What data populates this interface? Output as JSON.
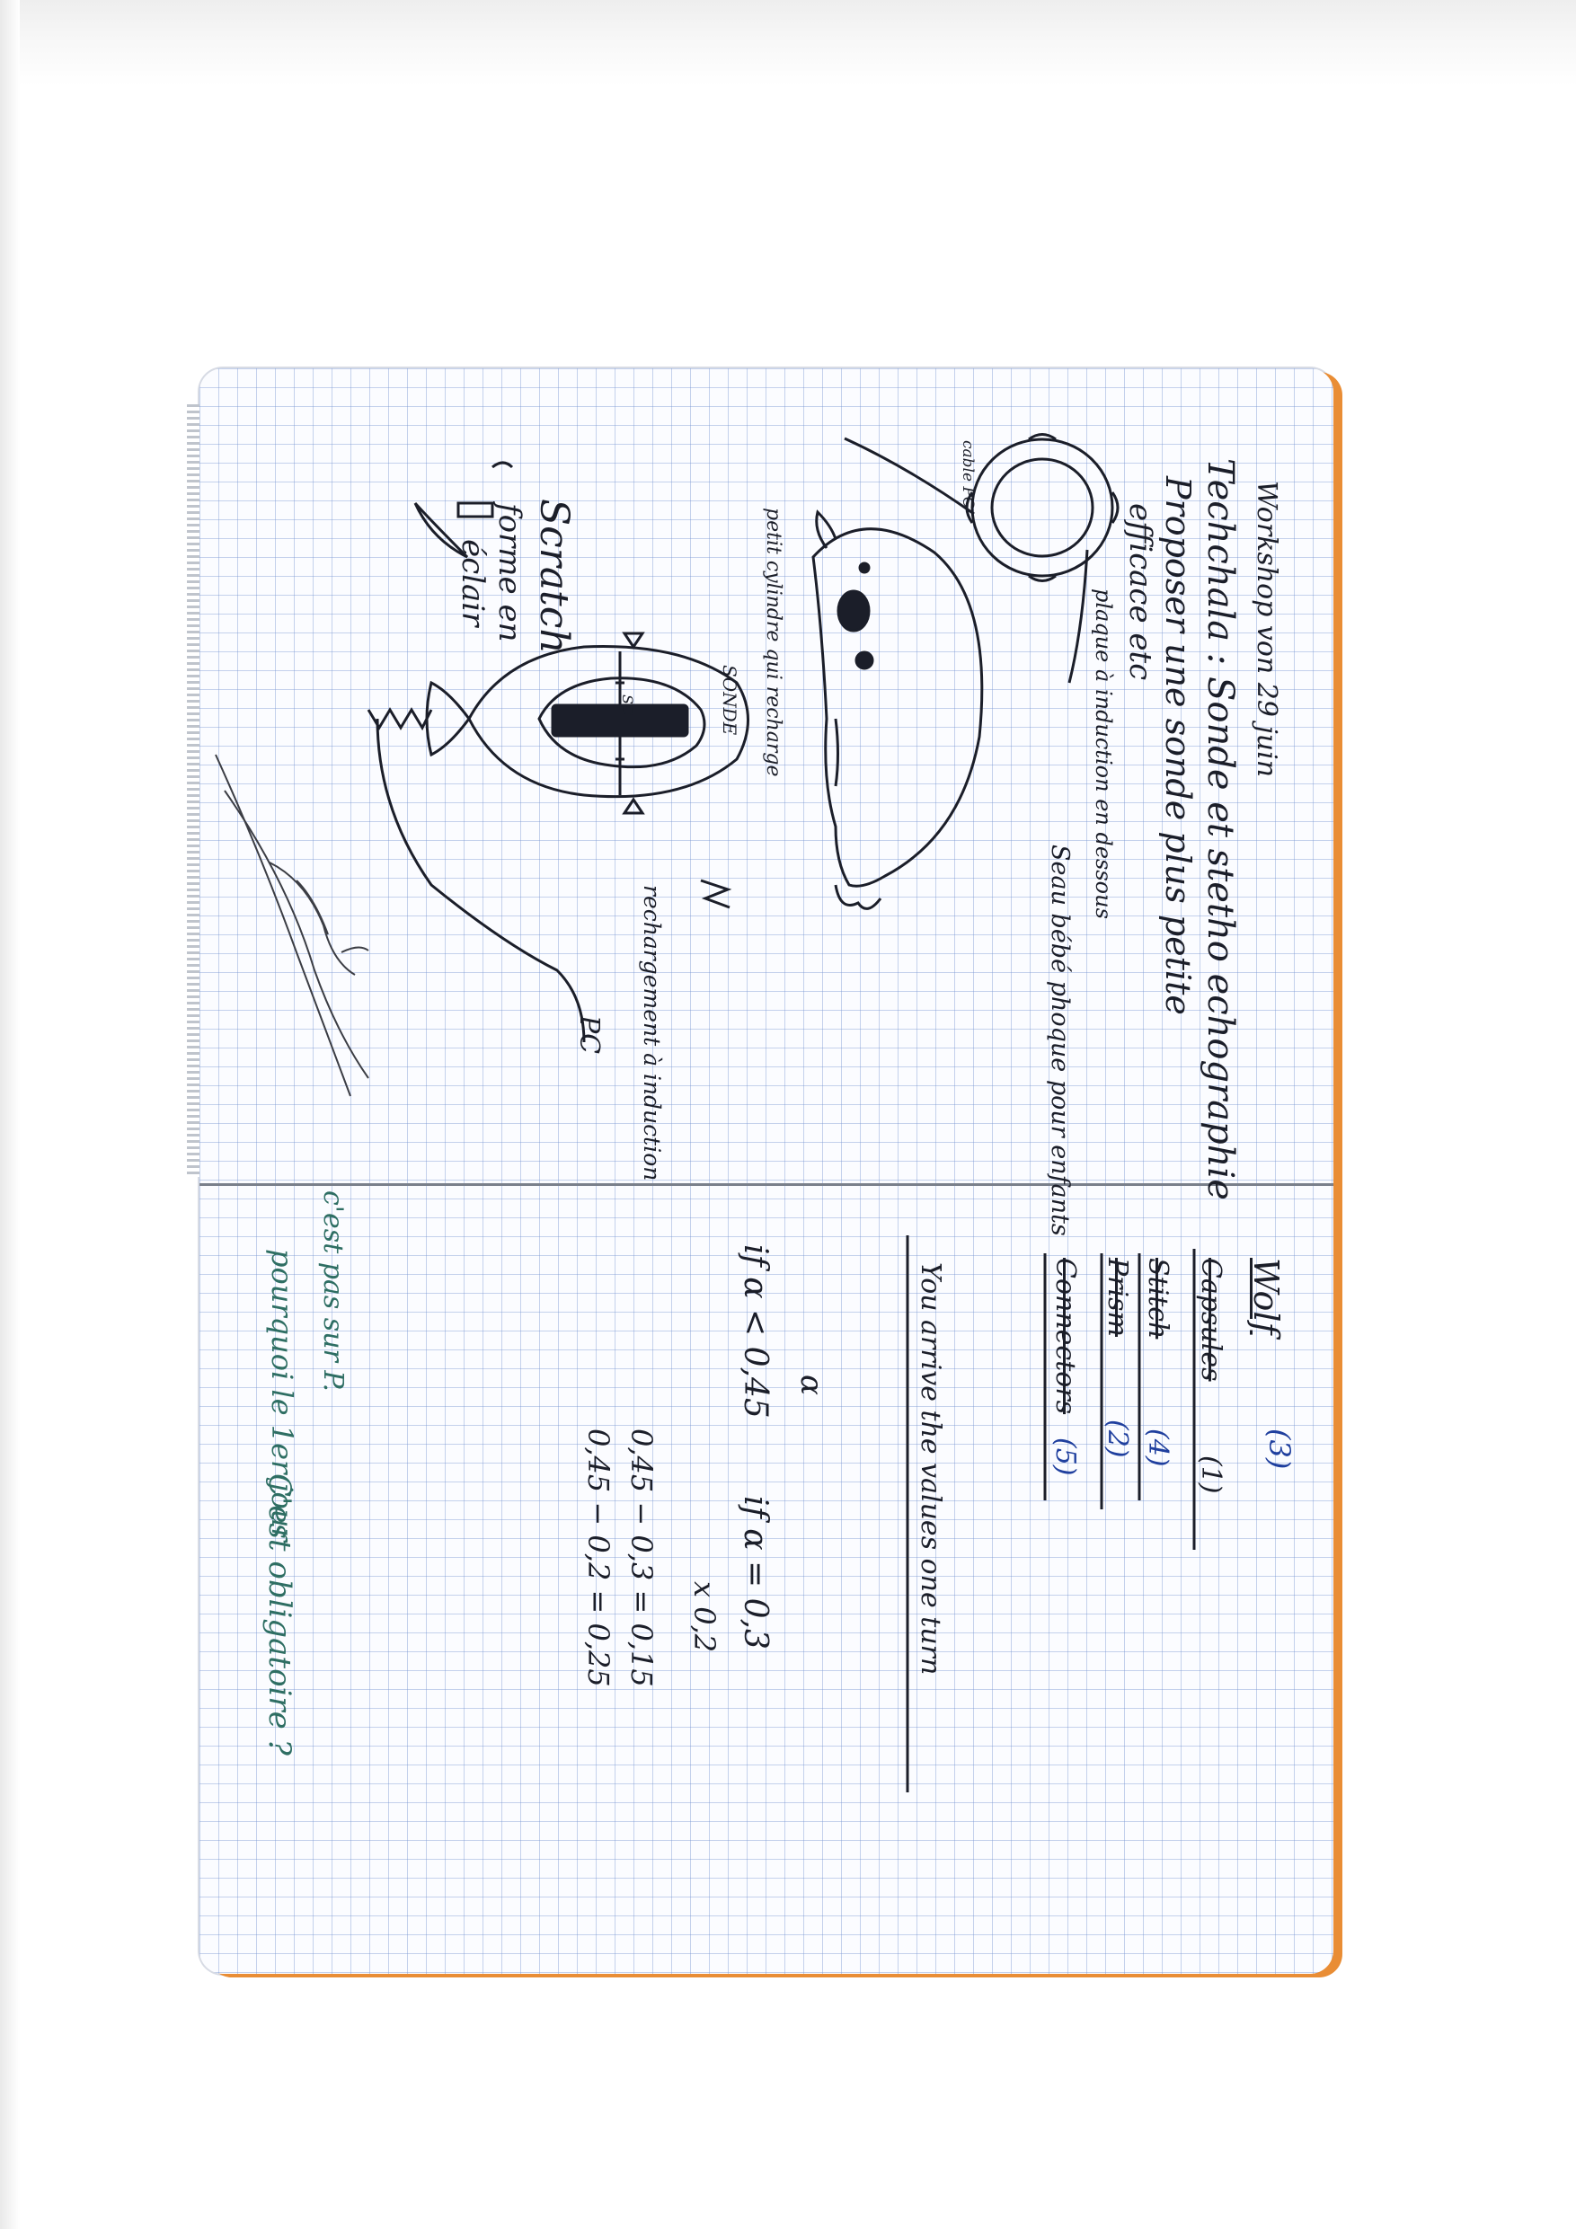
{
  "notebook": {
    "top_page": {
      "heading": "Workshop von 29 juin",
      "line1": "Techchala : Sonde et stetho echographie",
      "line2": "Proposer une sonde plus petite",
      "line3": "efficace etc",
      "cable_label": "cable PC",
      "plaque_label": "plaque à induction en dessous",
      "seal_label": "Seau bébé phoque pour enfants",
      "petit_label": "petit cylindre qui recharge",
      "sonde_label": "SONDE",
      "sc_label": "SC",
      "recharge_label": "rechargement à induction",
      "pc_label": "PC",
      "scratch_label": "Scratch",
      "forme_label": "forme en",
      "eclair_label": "éclair"
    },
    "bottom_page": {
      "vote_title": "Wolf",
      "vote_items": [
        {
          "name": "Capsules",
          "score": "(1)"
        },
        {
          "name": "Stitch",
          "score": "(4)"
        },
        {
          "name": "Prism",
          "score": "(2)"
        },
        {
          "name": "Connectors",
          "score": "(5)"
        }
      ],
      "vote_total": "(3)",
      "sentence": "You arrive the values one turn",
      "if1": "if  α < 0,45",
      "if2": "if  α = 0,3",
      "alpha": "α",
      "x_val": "x  0,2",
      "calc1": "0,45 − 0,3 = 0,15",
      "calc2": "0,45 − 0,2 = 0,25",
      "green_q": "C'est obligatoire ?",
      "green_a1": "pourquoi le 1er jour",
      "green_a2": "c'est pas sur P."
    }
  }
}
